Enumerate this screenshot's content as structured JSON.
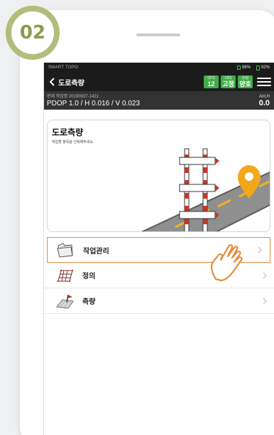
{
  "step": {
    "number": "02"
  },
  "status_bar": {
    "app_name": "SMART TOPO",
    "battery_gnss": "88%",
    "battery_device": "92%"
  },
  "title_bar": {
    "title": "도로측량",
    "gps": {
      "label": "GPS",
      "value": "12"
    },
    "vrs": {
      "label": "VRS",
      "value": "고정"
    },
    "quality": {
      "label": "보정",
      "value": "양호"
    }
  },
  "info_bar": {
    "job": "현재 작업명 20190927-1421",
    "precision": "PDOP 1.0 / H 0.016 / V 0.023",
    "ant_label": "Ant.H",
    "ant_value": "0.0"
  },
  "banner": {
    "title": "도로측량",
    "subtitle": "작업할 항목을 선택해주세요."
  },
  "menu": {
    "items": [
      {
        "label": "작업관리",
        "icon": "folder-icon",
        "selected": true
      },
      {
        "label": "정의",
        "icon": "grid-plane-icon",
        "selected": false
      },
      {
        "label": "측량",
        "icon": "survey-plane-icon",
        "selected": false
      }
    ]
  },
  "colors": {
    "badge": "#b2bd7c",
    "badge_text": "#8a9a4e",
    "gnss_green": "#3fae48",
    "selection": "#e48a3d",
    "appbar": "#1b1b1b",
    "infobar": "#333333"
  }
}
